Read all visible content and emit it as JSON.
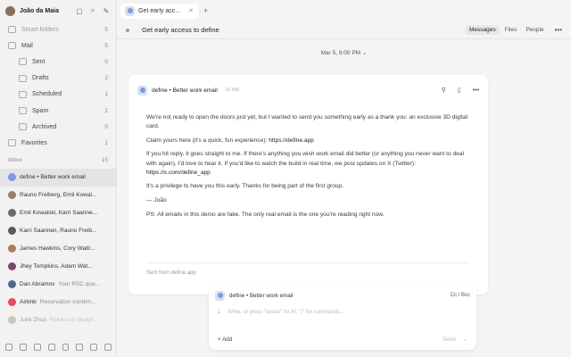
{
  "sidebar": {
    "user_name": "João da Maia",
    "nav": [
      {
        "label": "Smart folders",
        "count": "5",
        "muted": true
      },
      {
        "label": "Mail",
        "count": "5",
        "muted": false
      },
      {
        "label": "Sent",
        "count": "0",
        "sub": true
      },
      {
        "label": "Drafts",
        "count": "2",
        "sub": true
      },
      {
        "label": "Scheduled",
        "count": "1",
        "sub": true
      },
      {
        "label": "Spam",
        "count": "2",
        "sub": true
      },
      {
        "label": "Archived",
        "count": "0",
        "sub": true
      },
      {
        "label": "Favorites",
        "count": "1",
        "muted": false
      }
    ],
    "inbox_label": "Inbox",
    "inbox_count": "15",
    "inbox_items": [
      {
        "from": "define • Better work email",
        "subject": "",
        "color": "#7a9be0",
        "active": true
      },
      {
        "from": "Rauno Freiberg, Emil Kowal...",
        "subject": "",
        "color": "#9c7b6a"
      },
      {
        "from": "Emil Kowalski, Karri Saarine...",
        "subject": "",
        "color": "#6d6d6d"
      },
      {
        "from": "Karri Saarinen, Rauno Freib...",
        "subject": "",
        "color": "#5a5a5a"
      },
      {
        "from": "James Hawkins, Cory Watil...",
        "subject": "",
        "color": "#b07a5a"
      },
      {
        "from": "Jhey Tompkins, Adam Wat...",
        "subject": "",
        "color": "#7a4a6a"
      },
      {
        "from": "Dan Abramov",
        "subject": "Your RSC que...",
        "color": "#4a6a8a"
      },
      {
        "from": "Airbnb",
        "subject": "Reservation confirm...",
        "color": "#e0515f"
      },
      {
        "from": "Julie Zhuo",
        "subject": "Follow-up design...",
        "color": "#9a8a7a",
        "faded": true
      }
    ]
  },
  "tab": {
    "label": "Get early access to define"
  },
  "header": {
    "title": "Get early access to define",
    "messages": "Messages",
    "files": "Files",
    "people": "People"
  },
  "thread": {
    "date": "Mar 5, 9:00 PM"
  },
  "email": {
    "sender": "define • Better work email",
    "to": "to me",
    "p1": "We're not ready to open the doors just yet, but I wanted to send you something early as a thank you: an exclusive 3D digital card.",
    "p2_text": "Claim yours here (it's a quick, fun experience): ",
    "p2_link": "https://define.app",
    "p3_text": "If you hit reply, it goes straight to me. If there's anything you wish work email did better (or anything you never want to deal with again), I'd love to hear it. If you'd like to watch the build in real time, we post updates on X (Twitter): ",
    "p3_link": "https://x.com/define_app",
    "p4": "It's a privilege to have you this early. Thanks for being part of the first group.",
    "p5": "— João",
    "p6": "PS: All emails in this demo are fake. The only real email is the one you're reading right now.",
    "sent_from": "Sent from define.app"
  },
  "composer": {
    "sender": "define • Better work email",
    "cc_bcc": "Cc / Bcc",
    "line_number": "1",
    "placeholder": "Write, or press \"space\" for AI, \"/\" for commands...",
    "add": "Add",
    "send": "Send"
  }
}
